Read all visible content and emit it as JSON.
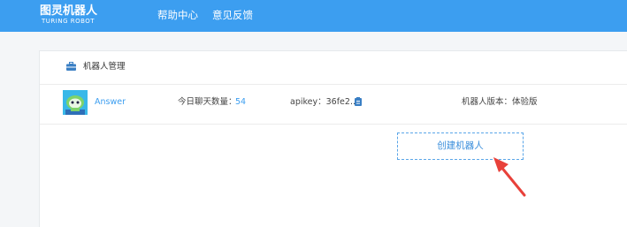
{
  "header": {
    "logo_cn": "图灵机器人",
    "logo_en": "TURING ROBOT",
    "nav": [
      {
        "label": "帮助中心"
      },
      {
        "label": "意见反馈"
      }
    ]
  },
  "panel": {
    "title": "机器人管理",
    "robot": {
      "name": "Answer",
      "today_chat_label": "今日聊天数量：",
      "today_chat_value": "54",
      "apikey": "apikey：36fe2...",
      "version": "机器人版本：体验版"
    },
    "create_button": "创建机器人"
  },
  "colors": {
    "header_bg": "#3c9ef0",
    "link": "#3c9ef0",
    "arrow": "#e8413a"
  }
}
